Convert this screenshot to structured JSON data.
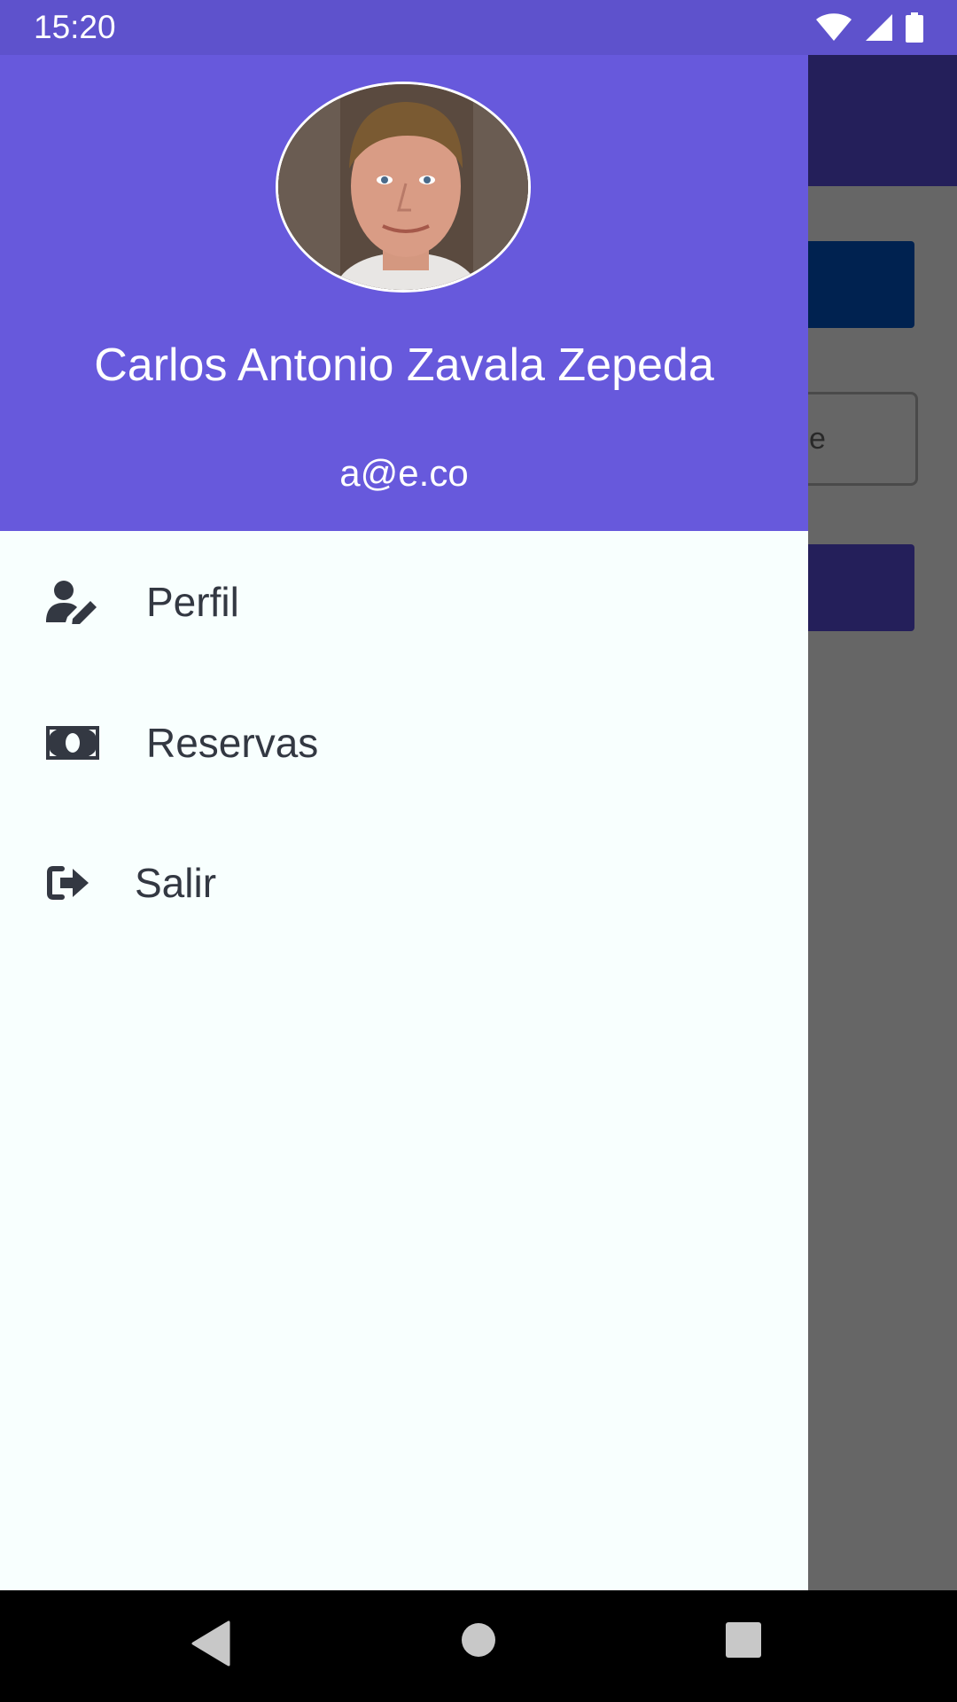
{
  "status_bar": {
    "time": "15:20",
    "icons": [
      "wifi-icon",
      "signal-icon",
      "battery-icon"
    ]
  },
  "background_app": {
    "input_partial_text": "e"
  },
  "drawer": {
    "header": {
      "avatar": "user-avatar-photo",
      "name": "Carlos Antonio Zavala Zepeda",
      "email": "a@e.co"
    },
    "items": [
      {
        "label": "Perfil",
        "icon": "user-edit-icon"
      },
      {
        "label": "Reservas",
        "icon": "money-bill-icon"
      },
      {
        "label": "Salir",
        "icon": "sign-out-icon"
      }
    ]
  },
  "navigation_bar": {
    "buttons": [
      "back-icon",
      "home-icon",
      "recents-icon"
    ]
  },
  "colors": {
    "status_bar": "#5e52cc",
    "drawer_header": "#6759dc",
    "drawer_body": "#f8fffe",
    "menu_text": "#333842"
  }
}
